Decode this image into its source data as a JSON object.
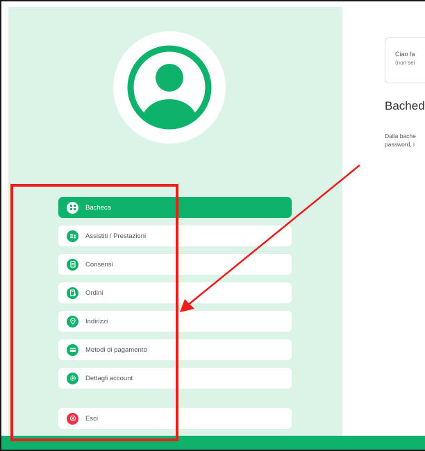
{
  "sidebar": {
    "avatar": {
      "icon": "user-avatar-icon"
    },
    "items": [
      {
        "label": "Bacheca",
        "icon": "dashboard-icon",
        "active": true
      },
      {
        "label": "Assistiti / Prestazioni",
        "icon": "people-list-icon"
      },
      {
        "label": "Consensi",
        "icon": "document-icon"
      },
      {
        "label": "Ordini",
        "icon": "order-icon"
      },
      {
        "label": "Indirizzi",
        "icon": "location-pin-icon"
      },
      {
        "label": "Metodi di pagamento",
        "icon": "payment-icon"
      },
      {
        "label": "Dettagli account",
        "icon": "account-settings-icon"
      },
      {
        "label": "Esci",
        "icon": "close-circle-icon"
      }
    ]
  },
  "main": {
    "greeting": {
      "line1": "Ciao fa",
      "line2": "(non sei"
    },
    "title": "Bached",
    "description_line1": "Dalla bache",
    "description_line2": "password, i"
  },
  "colors": {
    "accent": "#0db36a",
    "sidebar_bg": "#dcf3e8",
    "danger": "#e8334a",
    "annotation": "#ee1c1c"
  }
}
